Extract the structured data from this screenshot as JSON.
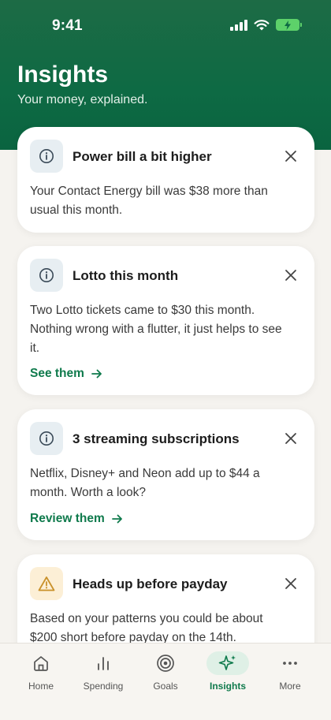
{
  "status": {
    "time": "9:41"
  },
  "header": {
    "title": "Insights",
    "subtitle": "Your money, explained."
  },
  "cards": [
    {
      "title": "Power bill a bit higher",
      "body": "Your Contact Energy bill was $38 more than usual this month.",
      "icon": "info-icon"
    },
    {
      "title": "Lotto this month",
      "body": "Two Lotto tickets came to $30 this month. Nothing wrong with a flutter, it just helps to see it.",
      "link": "See them",
      "icon": "info-icon"
    },
    {
      "title": "3 streaming subscriptions",
      "body": "Netflix, Disney+ and Neon add up to $44 a month. Worth a look?",
      "link": "Review them",
      "icon": "info-icon"
    },
    {
      "title": "Heads up before payday",
      "body": "Based on your patterns you could be about $200 short before payday on the 14th.",
      "icon": "warning-icon"
    }
  ],
  "tabs": [
    {
      "label": "Home",
      "icon": "home-icon"
    },
    {
      "label": "Spending",
      "icon": "bar-chart-icon"
    },
    {
      "label": "Goals",
      "icon": "target-icon"
    },
    {
      "label": "Insights",
      "icon": "sparkle-icon",
      "active": true
    },
    {
      "label": "More",
      "icon": "more-icon"
    }
  ],
  "colors": {
    "brand_green": "#0e6a44",
    "link_green": "#0f7a4c",
    "info_bg": "#e7eef2",
    "warning_bg": "#fcefd6",
    "warning_accent": "#c9912a",
    "active_tab_bg": "#dff0e6"
  }
}
